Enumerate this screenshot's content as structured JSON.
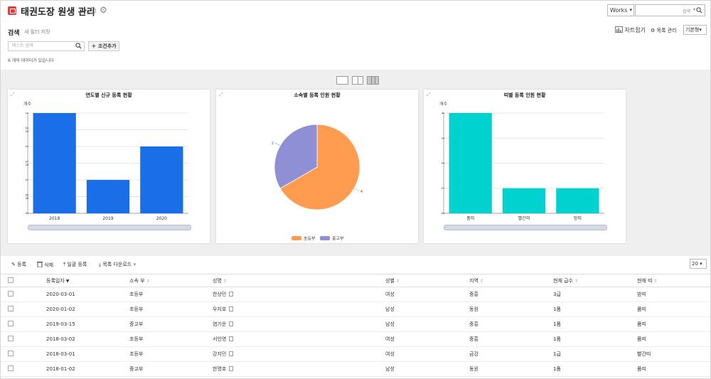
{
  "header": {
    "title": "태권도장 원생 관리",
    "works_label": "Works",
    "search_placeholder": "검색"
  },
  "filter": {
    "title": "검색",
    "save_filter": "새 필터 저장",
    "search_placeholder": "텍스트 검색",
    "add_condition": "조건추가",
    "count_text": "6 개의 데이터가 있습니다",
    "chart_fold": "차트접기",
    "list_manage": "목록 관리",
    "view_select": "기본형"
  },
  "charts": [
    {
      "title": "연도별 신규 등록 현황"
    },
    {
      "title": "소속별 등록 인원 현황"
    },
    {
      "title": "띠별 등록 인원 현황"
    }
  ],
  "chart_data": [
    {
      "type": "bar",
      "title": "연도별 신규 등록 현황",
      "ylabel": "개수",
      "categories": [
        "2018",
        "2019",
        "2020"
      ],
      "values": [
        3,
        1,
        2
      ],
      "ylim": [
        0,
        3
      ],
      "yticks": [
        "0",
        "0.5",
        "1",
        "1.5",
        "2",
        "2.5",
        "3"
      ],
      "color": "#1a6fe8",
      "grid": true
    },
    {
      "type": "pie",
      "title": "소속별 등록 인원 현황",
      "categories": [
        "초등부",
        "중고부"
      ],
      "values": [
        4,
        2
      ],
      "colors": [
        "#ff9c50",
        "#8f8fd6"
      ],
      "legend": "bottom"
    },
    {
      "type": "bar",
      "title": "띠별 등록 인원 현황",
      "ylabel": "개수",
      "categories": [
        "품띠",
        "빨간띠",
        "밤띠"
      ],
      "values": [
        4,
        1,
        1
      ],
      "ylim": [
        0,
        4
      ],
      "yticks": [
        "0",
        "1",
        "2",
        "3",
        "4"
      ],
      "color": "#00d2cf",
      "grid": true
    }
  ],
  "toolbar": {
    "register": "등록",
    "delete": "삭제",
    "bulk_register": "일괄 등록",
    "download": "목록 다운로드",
    "page_size": "20"
  },
  "table": {
    "columns": [
      "등록일자",
      "소속 부",
      "성명",
      "성별",
      "지역",
      "현재 급수",
      "현재 띠"
    ],
    "rows": [
      [
        "2020-03-01",
        "초등부",
        "한상민",
        "여성",
        "중흥",
        "3급",
        "밤띠"
      ],
      [
        "2020-01-02",
        "초등부",
        "우지호",
        "남성",
        "동원",
        "1품",
        "품띠"
      ],
      [
        "2019-03-15",
        "중고부",
        "염기운",
        "남성",
        "중흥",
        "1품",
        "품띠"
      ],
      [
        "2018-03-02",
        "초등부",
        "서인영",
        "여성",
        "중흥",
        "1품",
        "품띠"
      ],
      [
        "2018-03-01",
        "초등부",
        "강지민",
        "여성",
        "금강",
        "1급",
        "빨간띠"
      ],
      [
        "2018-01-02",
        "중고부",
        "한명호",
        "남성",
        "동원",
        "1품",
        "품띠"
      ]
    ]
  }
}
